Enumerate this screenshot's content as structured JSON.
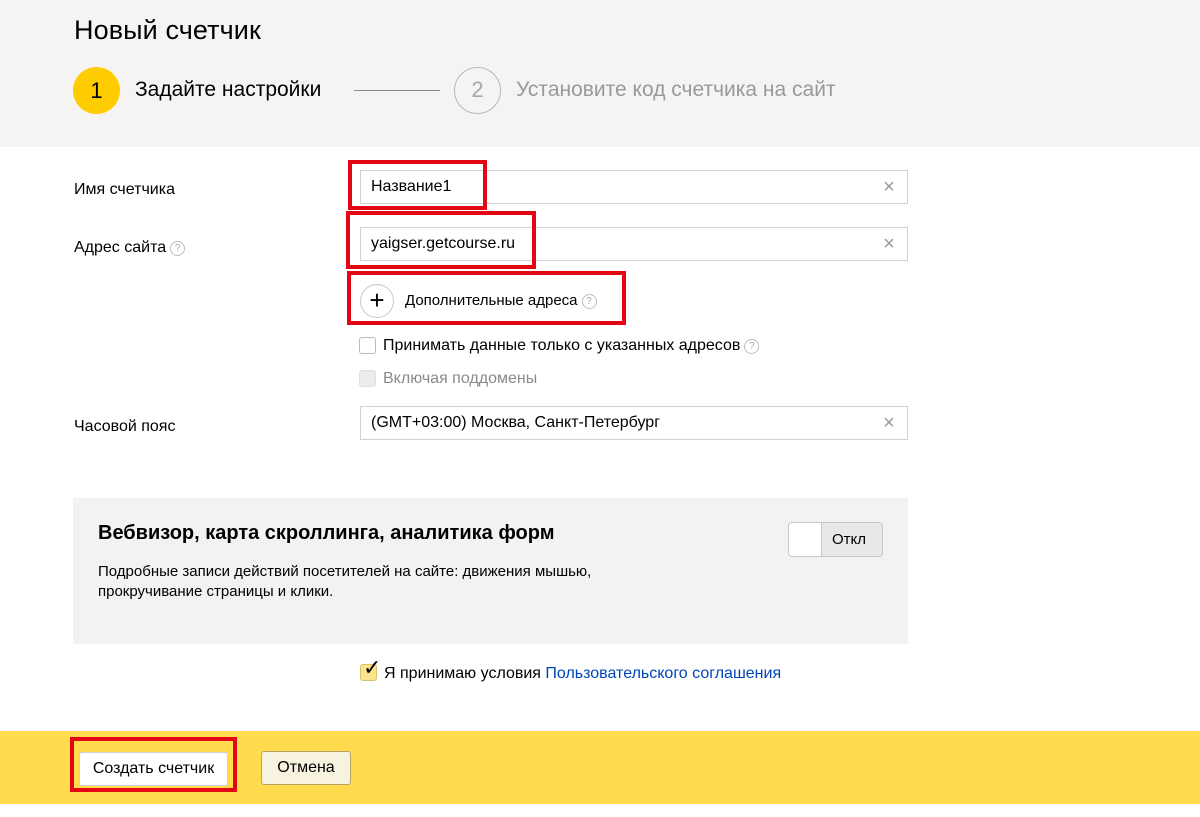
{
  "header": {
    "title": "Новый счетчик",
    "steps": [
      {
        "number": "1",
        "label": "Задайте настройки"
      },
      {
        "number": "2",
        "label": "Установите код счетчика на сайт"
      }
    ]
  },
  "form": {
    "counter_name": {
      "label": "Имя счетчика",
      "value": "Название1"
    },
    "site_address": {
      "label": "Адрес сайта",
      "value": "yaigser.getcourse.ru"
    },
    "additional_addresses": {
      "label": "Дополнительные адреса"
    },
    "accept_only_listed": {
      "label": "Принимать данные только с указанных адресов",
      "checked": false
    },
    "include_subdomains": {
      "label": "Включая поддомены",
      "checked": false,
      "disabled": true
    },
    "timezone": {
      "label": "Часовой пояс",
      "value": "(GMT+03:00) Москва, Санкт-Петербург"
    }
  },
  "webvisor": {
    "title": "Вебвизор, карта скроллинга, аналитика форм",
    "description": "Подробные записи действий посетителей на сайте: движения мышью, прокручивание страницы и клики.",
    "toggle_label": "Откл",
    "enabled": false
  },
  "agreement": {
    "text": "Я принимаю условия ",
    "link": "Пользовательского соглашения",
    "checked": true
  },
  "footer": {
    "create_label": "Создать счетчик",
    "cancel_label": "Отмена"
  },
  "icons": {
    "help": "question-circle-icon",
    "clear": "close-icon",
    "add": "plus-icon",
    "check": "checkmark-icon"
  },
  "colors": {
    "accent": "#ffcc00",
    "footer_bg": "#ffdb4d",
    "highlight": "#e30613",
    "link": "#0044bb"
  }
}
